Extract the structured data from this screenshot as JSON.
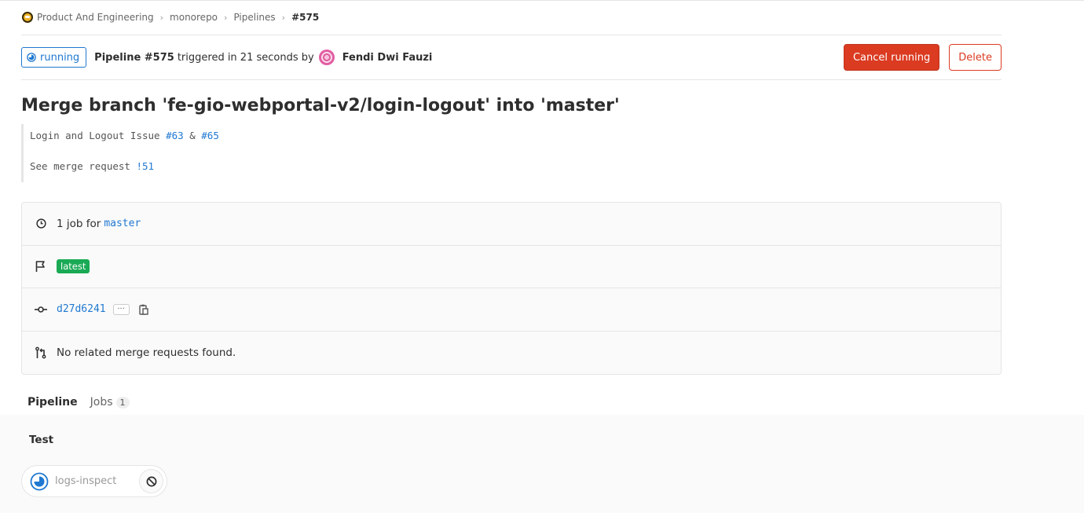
{
  "breadcrumb": {
    "items": [
      {
        "label": "Product And Engineering"
      },
      {
        "label": "monorepo"
      },
      {
        "label": "Pipelines"
      },
      {
        "label": "#575"
      }
    ]
  },
  "header": {
    "status": "running",
    "pipeline_label": "Pipeline #575",
    "triggered_text": "triggered in 21 seconds by",
    "user_name": "Fendi Dwi Fauzi",
    "cancel_label": "Cancel running",
    "delete_label": "Delete"
  },
  "commit": {
    "title": "Merge branch 'fe-gio-webportal-v2/login-logout' into 'master'",
    "desc_line1_prefix": "Login and Logout Issue",
    "issue1": "#63",
    "amp": "&",
    "issue2": "#65",
    "desc_line2_prefix": "See merge request",
    "mr_ref": "!51"
  },
  "info": {
    "jobs_text": "1 job for",
    "branch": "master",
    "tag_latest": "latest",
    "sha": "d27d6241",
    "ellipsis": "···",
    "mr_text": "No related merge requests found."
  },
  "tabs": [
    {
      "label": "Pipeline",
      "active": true
    },
    {
      "label": "Jobs",
      "count": "1"
    }
  ],
  "graph": {
    "stage": "Test",
    "job_name": "logs-inspect"
  },
  "colors": {
    "running": "#1f78d1",
    "danger": "#db3b21",
    "success": "#1aaa55",
    "tab_active": "#6b4fbb"
  }
}
